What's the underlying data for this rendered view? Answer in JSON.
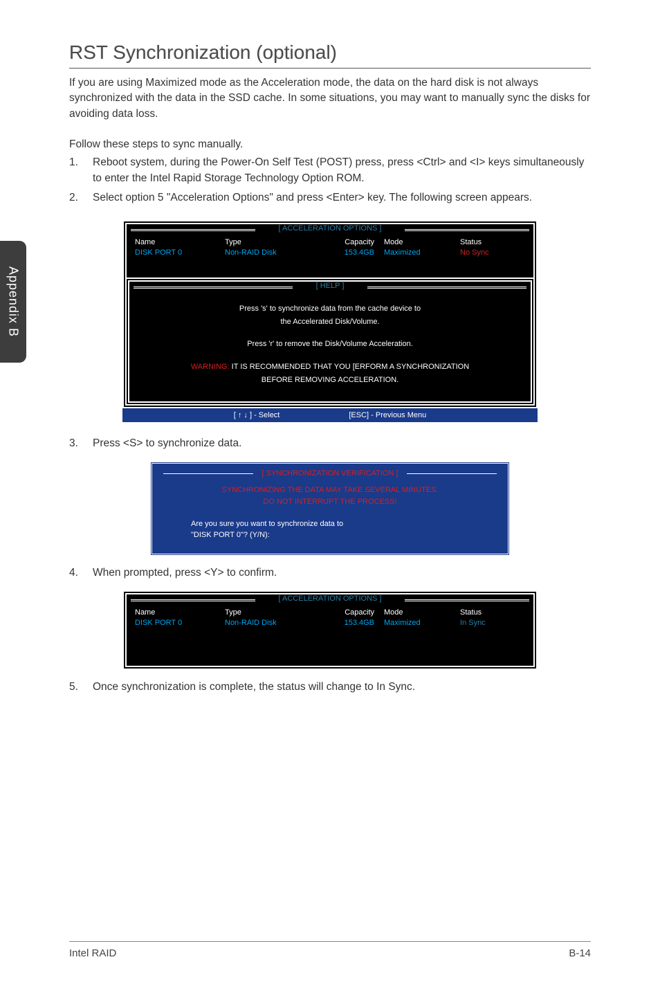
{
  "side_tab": "Appendix B",
  "title": "RST Synchronization (optional)",
  "intro": "If you are using Maximized mode as the Acceleration mode, the data on the hard disk is not always synchronized with the data in the SSD cache. In some situations, you may want to manually sync the disks for avoiding data loss.",
  "follow": "Follow these steps to sync manually.",
  "steps": [
    "Reboot system, during the Power-On Self Test (POST) press, press <Ctrl> and <I> keys simultaneously to enter the Intel Rapid Storage Technology Option ROM.",
    "Select option 5 \"Acceleration Options\" and press <Enter> key. The following screen appears.",
    "Press <S> to synchronize data.",
    "When prompted, press <Y> to confirm.",
    "Once synchronization is complete, the status will change to In Sync."
  ],
  "bios1": {
    "section_label": "[ ACCELERATION OPTIONS ]",
    "headers": {
      "name": "Name",
      "type": "Type",
      "capacity": "Capacity",
      "mode": "Mode",
      "status": "Status"
    },
    "row": {
      "name": "DISK PORT 0",
      "type": "Non-RAID Disk",
      "capacity": "153.4GB",
      "mode": "Maximized",
      "status": "No Sync"
    },
    "help_label": "[  HELP  ]",
    "help_line1": "Press 's' to synchronize data from the cache device to",
    "help_line2": "the Accelerated Disk/Volume.",
    "help_line3": "Press 'r' to remove the Disk/Volume Acceleration.",
    "warning_prefix": "WARNING:",
    "warning_text": " IT IS RECOMMENDED THAT YOU [ERFORM A SYNCHRONIZATION",
    "warning_line2": "BEFORE REMOVING ACCELERATION.",
    "footer_left": "[ ↑ ↓ ] - Select",
    "footer_right": "[ESC] - Previous Menu"
  },
  "sync_box": {
    "title": "[ SYNCHRONIZATION VERIFICATION ]",
    "red1": "SYNCHRONIZING THE DATA MAY TAKE SEVERAL MINUTES.",
    "red2": "DO NOT INTERRUPT THE PROCESS!",
    "prompt1": "Are you sure you want to synchronize data to",
    "prompt2": "\"DISK PORT 0\"? (Y/N):"
  },
  "bios2": {
    "section_label": "[ ACCELERATION OPTIONS ]",
    "headers": {
      "name": "Name",
      "type": "Type",
      "capacity": "Capacity",
      "mode": "Mode",
      "status": "Status"
    },
    "row": {
      "name": "DISK PORT 0",
      "type": "Non-RAID Disk",
      "capacity": "153.4GB",
      "mode": "Maximized",
      "status": "In Sync"
    }
  },
  "footer": {
    "left": "Intel RAID",
    "right": "B-14"
  }
}
